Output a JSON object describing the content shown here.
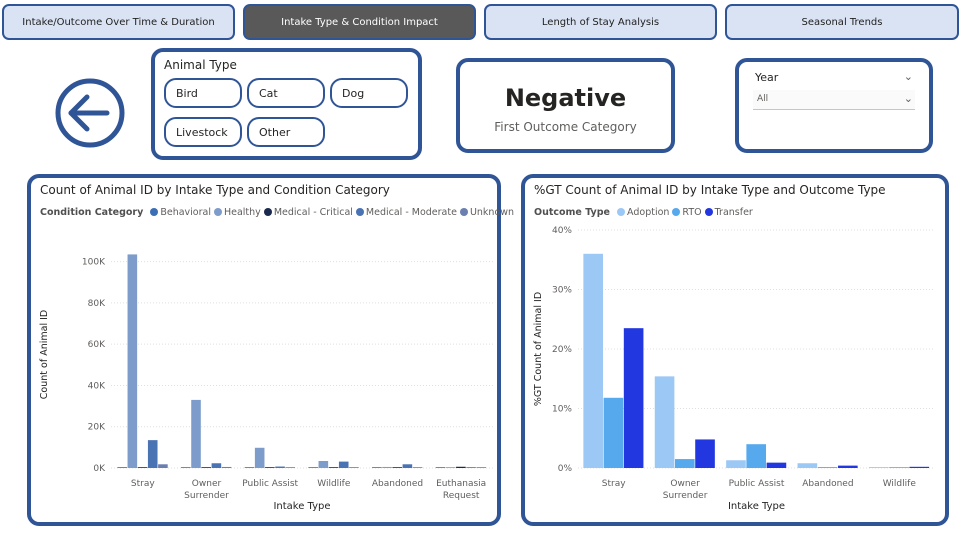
{
  "tabs": [
    {
      "label": "Intake/Outcome Over Time & Duration",
      "active": false
    },
    {
      "label": "Intake Type & Condition Impact",
      "active": true
    },
    {
      "label": "Length of Stay Analysis",
      "active": false
    },
    {
      "label": "Seasonal Trends",
      "active": false
    }
  ],
  "icons": {
    "back": "back-arrow-icon",
    "chevron": "chevron-down-icon"
  },
  "colors": {
    "accent": "#2f5597",
    "tab_bg": "#dae3f3",
    "tab_active_bg": "#595959"
  },
  "animal_slicer": {
    "title": "Animal Type",
    "options": [
      "Bird",
      "Cat",
      "Dog",
      "Livestock",
      "Other"
    ]
  },
  "kpi": {
    "value": "Negative",
    "label": "First Outcome Category"
  },
  "year_filter": {
    "title": "Year",
    "value": "All"
  },
  "chart_data": [
    {
      "type": "bar",
      "title": "Count of Animal ID by Intake Type and Condition Category",
      "legend_title": "Condition Category",
      "xlabel": "Intake Type",
      "ylabel": "Count of Animal ID",
      "categories": [
        [
          "Stray"
        ],
        [
          "Owner",
          "Surrender"
        ],
        [
          "Public Assist"
        ],
        [
          "Wildlife"
        ],
        [
          "Abandoned"
        ],
        [
          "Euthanasia",
          "Request"
        ]
      ],
      "ylim": [
        0,
        110000
      ],
      "yticks": [
        0,
        20000,
        40000,
        60000,
        80000,
        100000
      ],
      "ytick_labels": [
        "0K",
        "20K",
        "40K",
        "60K",
        "80K",
        "100K"
      ],
      "series": [
        {
          "name": "Behavioral",
          "color": "#3a6fb5",
          "values": [
            400,
            150,
            50,
            20,
            30,
            10
          ]
        },
        {
          "name": "Healthy",
          "color": "#7d9ccb",
          "values": [
            103500,
            33000,
            9800,
            3400,
            500,
            200
          ]
        },
        {
          "name": "Medical - Critical",
          "color": "#1a2a4f",
          "values": [
            300,
            200,
            100,
            300,
            100,
            600
          ]
        },
        {
          "name": "Medical - Moderate",
          "color": "#4a73b4",
          "values": [
            13500,
            2300,
            700,
            3100,
            1800,
            200
          ]
        },
        {
          "name": "Unknown",
          "color": "#6b7fb1",
          "values": [
            1800,
            500,
            200,
            400,
            200,
            100
          ]
        }
      ],
      "legend": "top-left",
      "grid": true
    },
    {
      "type": "bar",
      "title": "%GT Count of Animal ID by Intake Type and Outcome Type",
      "legend_title": "Outcome Type",
      "xlabel": "Intake Type",
      "ylabel": "%GT Count of Animal ID",
      "categories": [
        [
          "Stray"
        ],
        [
          "Owner",
          "Surrender"
        ],
        [
          "Public Assist"
        ],
        [
          "Abandoned"
        ],
        [
          "Wildlife"
        ]
      ],
      "ylim": [
        0,
        40
      ],
      "yticks": [
        0,
        10,
        20,
        30,
        40
      ],
      "ytick_labels": [
        "0%",
        "10%",
        "20%",
        "30%",
        "40%"
      ],
      "series": [
        {
          "name": "Adoption",
          "color": "#9cc8f5",
          "values": [
            36,
            15.4,
            1.3,
            0.8,
            0.15
          ]
        },
        {
          "name": "RTO",
          "color": "#56a9ec",
          "values": [
            11.8,
            1.5,
            4,
            0.15,
            0.1
          ]
        },
        {
          "name": "Transfer",
          "color": "#2237e0",
          "values": [
            23.5,
            4.8,
            0.9,
            0.4,
            0.2
          ]
        }
      ],
      "legend": "top-left",
      "grid": true
    }
  ]
}
